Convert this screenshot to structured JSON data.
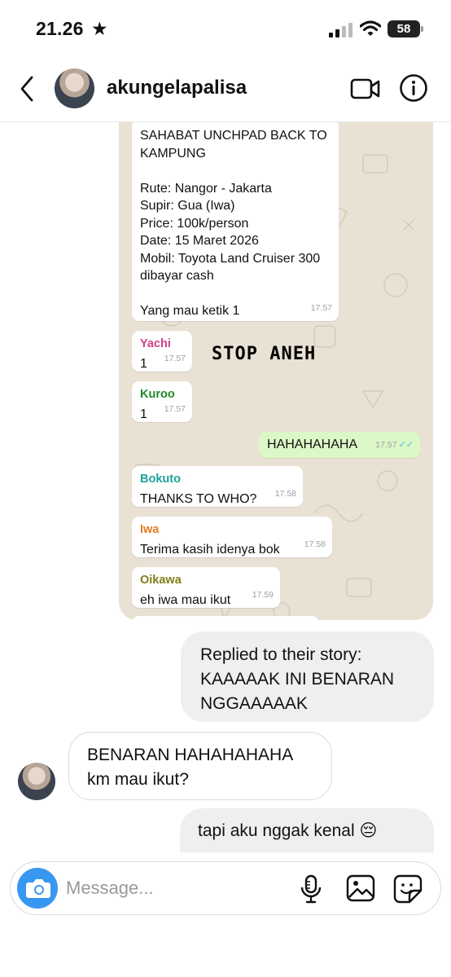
{
  "status_bar": {
    "time": "21.26",
    "star": "★",
    "battery": "58"
  },
  "header": {
    "username": "akungelapalisa",
    "icons": [
      "back-icon",
      "video-call-icon",
      "info-icon"
    ]
  },
  "story": {
    "messages": [
      {
        "sender": "",
        "lines": [
          "SAHABAT UNCHPAD BACK TO",
          "KAMPUNG",
          "",
          "Rute: Nangor - Jakarta",
          "Supir: Gua (Iwa)",
          "Price: 100k/person",
          "Date: 15 Maret 2026",
          "Mobil: Toyota Land Cruiser 300",
          "dibayar cash",
          "",
          "Yang mau ketik 1"
        ],
        "time": "17.57"
      },
      {
        "sender": "Yachi",
        "text": "1",
        "time": "17.57",
        "color": "#d23f8a"
      },
      {
        "sender": "Kuroo",
        "text": "1",
        "time": "17.57",
        "color": "#1f8a2a"
      },
      {
        "sender": "",
        "text": "HAHAHAHAHA",
        "time": "17.57",
        "outgoing": true
      },
      {
        "sender": "Bokuto",
        "text": "THANKS TO WHO?",
        "time": "17.58",
        "color": "#1aa39a"
      },
      {
        "sender": "Iwa",
        "text": "Terima kasih idenya bok",
        "time": "17.58",
        "color": "#e67e22"
      },
      {
        "sender": "Oikawa",
        "text": "eh iwa mau ikut",
        "time": "17.59",
        "color": "#7f7f17"
      }
    ],
    "overlay_text": "STOP ANEH"
  },
  "dm": {
    "reply_label": "Replied to their story:",
    "reply_text_line1": "KAAAAAK INI BENARAN",
    "reply_text_line2": "NGGAAAAAK",
    "their_line1": "BENARAN HAHAHAHAHA",
    "their_line2": "km mau ikut?",
    "mine_last": "tapi aku nggak kenal 😔"
  },
  "composer": {
    "placeholder": "Message...",
    "icons": [
      "camera-icon",
      "microphone-icon",
      "gallery-icon",
      "sticker-icon"
    ]
  }
}
